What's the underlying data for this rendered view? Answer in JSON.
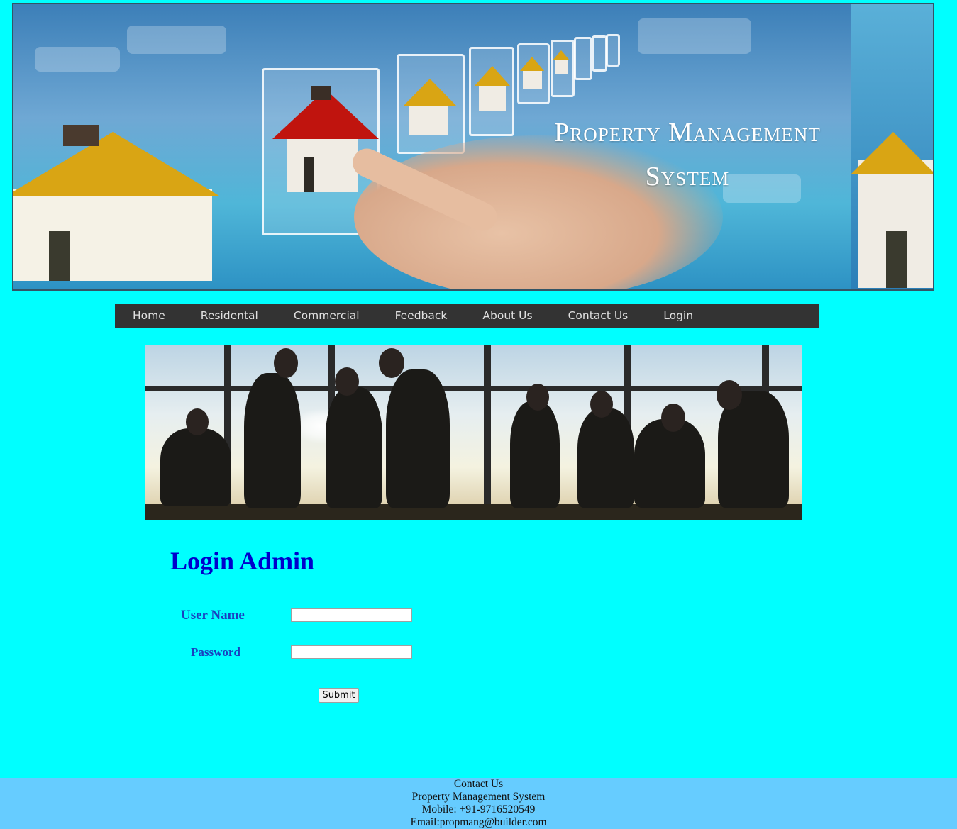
{
  "header": {
    "banner_title_line1": "Property Management",
    "banner_title_line2": "System"
  },
  "nav": {
    "items": [
      {
        "label": "Home"
      },
      {
        "label": "Residental"
      },
      {
        "label": "Commercial"
      },
      {
        "label": "Feedback"
      },
      {
        "label": "About Us"
      },
      {
        "label": "Contact Us"
      },
      {
        "label": "Login"
      }
    ]
  },
  "login": {
    "title": "Login Admin",
    "username_label": "User Name",
    "username_value": "",
    "password_label": "Password",
    "password_value": "",
    "submit_label": "Submit"
  },
  "footer": {
    "line1": "Contact Us",
    "line2": "Property Management System",
    "line3": "Mobile: +91-9716520549",
    "line4": "Email:propmang@builder.com"
  },
  "colors": {
    "page_background": "#00ffff",
    "nav_background": "#333333",
    "footer_background": "#66ccff",
    "login_title": "#0000cc",
    "label_text": "#1a3fbf"
  }
}
